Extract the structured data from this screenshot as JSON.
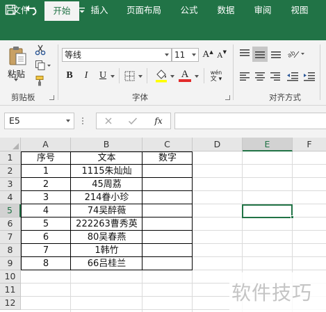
{
  "tabs": [
    "文件",
    "开始",
    "插入",
    "页面布局",
    "公式",
    "数据",
    "审阅",
    "视图"
  ],
  "active_tab": "开始",
  "ribbon": {
    "clipboard": {
      "paste_label": "粘贴",
      "group_label": "剪贴板"
    },
    "font": {
      "font_name": "等线",
      "font_size": "11",
      "bold": "B",
      "italic": "I",
      "underline": "U",
      "grow_font": "A",
      "shrink_font": "A",
      "font_color_letter": "A",
      "phonetic": "wén",
      "group_label": "字体",
      "font_color": "#e22b2b",
      "fill_color": "#ffff00"
    },
    "alignment": {
      "group_label": "对齐方式"
    }
  },
  "formula_bar": {
    "name_box": "E5",
    "fx": "fx",
    "formula": ""
  },
  "columns": [
    "A",
    "B",
    "C",
    "D",
    "E",
    "F"
  ],
  "selected_column": "E",
  "rows": [
    "1",
    "2",
    "3",
    "4",
    "5",
    "6",
    "7",
    "8",
    "9",
    "10",
    "11",
    "12"
  ],
  "selected_row": "5",
  "table": {
    "headers": [
      "序号",
      "文本",
      "数字"
    ],
    "data": [
      [
        "1",
        "1115朱灿灿",
        ""
      ],
      [
        "2",
        "45周荔",
        ""
      ],
      [
        "3",
        "214眷小珍",
        ""
      ],
      [
        "4",
        "74吴醉薇",
        ""
      ],
      [
        "5",
        "222263曹秀英",
        ""
      ],
      [
        "6",
        "80吴春燕",
        ""
      ],
      [
        "7",
        "1韩竹",
        ""
      ],
      [
        "8",
        "66吕桂兰",
        ""
      ]
    ]
  },
  "watermark": "软件技巧",
  "accent_color": "#217346"
}
